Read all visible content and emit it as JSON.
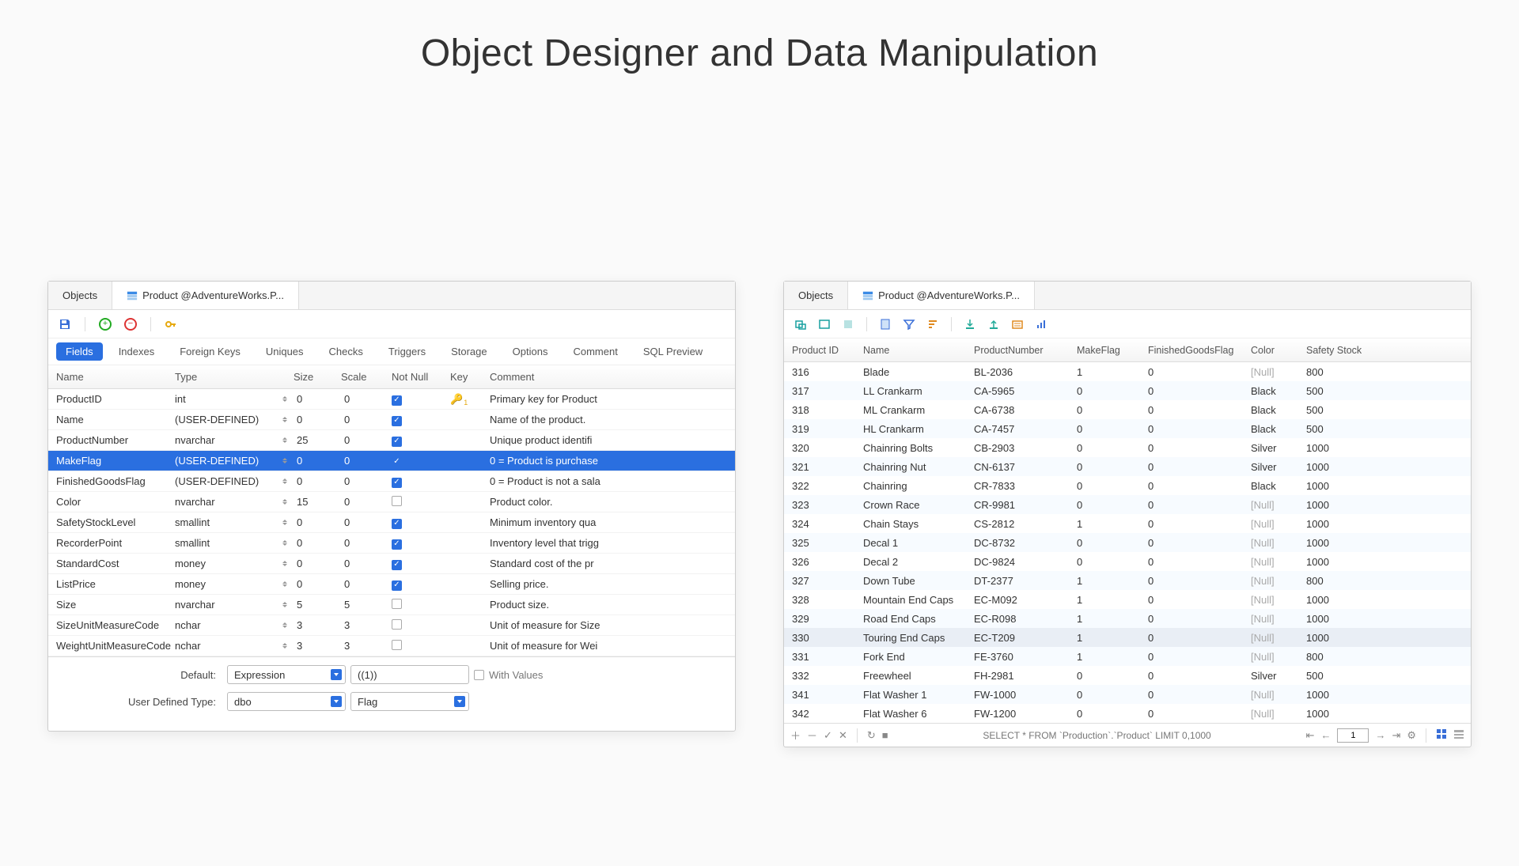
{
  "page": {
    "title": "Object Designer and Data Manipulation"
  },
  "designer": {
    "tabs": {
      "objects": "Objects",
      "product": "Product @AdventureWorks.P..."
    },
    "subtabs": [
      "Fields",
      "Indexes",
      "Foreign Keys",
      "Uniques",
      "Checks",
      "Triggers",
      "Storage",
      "Options",
      "Comment",
      "SQL Preview"
    ],
    "activeSubtab": 0,
    "columns": [
      "Name",
      "Type",
      "Size",
      "Scale",
      "Not Null",
      "Key",
      "Comment"
    ],
    "selectedRowIndex": 3,
    "rows": [
      {
        "name": "ProductID",
        "type": "int",
        "size": "0",
        "scale": "0",
        "notnull": true,
        "key": true,
        "comment": "Primary key for Product"
      },
      {
        "name": "Name",
        "type": "(USER-DEFINED)",
        "size": "0",
        "scale": "0",
        "notnull": true,
        "key": false,
        "comment": "Name of the product."
      },
      {
        "name": "ProductNumber",
        "type": "nvarchar",
        "size": "25",
        "scale": "0",
        "notnull": true,
        "key": false,
        "comment": "Unique product identifi"
      },
      {
        "name": "MakeFlag",
        "type": "(USER-DEFINED)",
        "size": "0",
        "scale": "0",
        "notnull": true,
        "key": false,
        "comment": "0 = Product is purchase"
      },
      {
        "name": "FinishedGoodsFlag",
        "type": "(USER-DEFINED)",
        "size": "0",
        "scale": "0",
        "notnull": true,
        "key": false,
        "comment": "0 = Product is not a sala"
      },
      {
        "name": "Color",
        "type": "nvarchar",
        "size": "15",
        "scale": "0",
        "notnull": false,
        "key": false,
        "comment": "Product color."
      },
      {
        "name": "SafetyStockLevel",
        "type": "smallint",
        "size": "0",
        "scale": "0",
        "notnull": true,
        "key": false,
        "comment": "Minimum inventory qua"
      },
      {
        "name": "RecorderPoint",
        "type": "smallint",
        "size": "0",
        "scale": "0",
        "notnull": true,
        "key": false,
        "comment": "Inventory level that trigg"
      },
      {
        "name": "StandardCost",
        "type": "money",
        "size": "0",
        "scale": "0",
        "notnull": true,
        "key": false,
        "comment": "Standard cost of the pr"
      },
      {
        "name": "ListPrice",
        "type": "money",
        "size": "0",
        "scale": "0",
        "notnull": true,
        "key": false,
        "comment": "Selling price."
      },
      {
        "name": "Size",
        "type": "nvarchar",
        "size": "5",
        "scale": "5",
        "notnull": false,
        "key": false,
        "comment": "Product size."
      },
      {
        "name": "SizeUnitMeasureCode",
        "type": "nchar",
        "size": "3",
        "scale": "3",
        "notnull": false,
        "key": false,
        "comment": "Unit of measure for Size"
      },
      {
        "name": "WeightUnitMeasureCode",
        "type": "nchar",
        "size": "3",
        "scale": "3",
        "notnull": false,
        "key": false,
        "comment": "Unit of measure for Wei"
      }
    ],
    "form": {
      "defaultLabel": "Default:",
      "defaultMode": "Expression",
      "defaultValue": "((1))",
      "withValues": "With Values",
      "udtLabel": "User Defined Type:",
      "udtSchema": "dbo",
      "udtName": "Flag"
    }
  },
  "dataview": {
    "tabs": {
      "objects": "Objects",
      "product": "Product @AdventureWorks.P..."
    },
    "columns": [
      "Product ID",
      "Name",
      "ProductNumber",
      "MakeFlag",
      "FinishedGoodsFlag",
      "Color",
      "Safety Stock"
    ],
    "rows": [
      {
        "pid": "316",
        "name": "Blade",
        "pn": "BL-2036",
        "mf": "1",
        "fg": "0",
        "color": "[Null]",
        "ss": "800"
      },
      {
        "pid": "317",
        "name": "LL Crankarm",
        "pn": "CA-5965",
        "mf": "0",
        "fg": "0",
        "color": "Black",
        "ss": "500"
      },
      {
        "pid": "318",
        "name": "ML Crankarm",
        "pn": "CA-6738",
        "mf": "0",
        "fg": "0",
        "color": "Black",
        "ss": "500"
      },
      {
        "pid": "319",
        "name": "HL Crankarm",
        "pn": "CA-7457",
        "mf": "0",
        "fg": "0",
        "color": "Black",
        "ss": "500"
      },
      {
        "pid": "320",
        "name": "Chainring Bolts",
        "pn": "CB-2903",
        "mf": "0",
        "fg": "0",
        "color": "Silver",
        "ss": "1000"
      },
      {
        "pid": "321",
        "name": "Chainring Nut",
        "pn": "CN-6137",
        "mf": "0",
        "fg": "0",
        "color": "Silver",
        "ss": "1000"
      },
      {
        "pid": "322",
        "name": "Chainring",
        "pn": "CR-7833",
        "mf": "0",
        "fg": "0",
        "color": "Black",
        "ss": "1000"
      },
      {
        "pid": "323",
        "name": "Crown Race",
        "pn": "CR-9981",
        "mf": "0",
        "fg": "0",
        "color": "[Null]",
        "ss": "1000"
      },
      {
        "pid": "324",
        "name": "Chain Stays",
        "pn": "CS-2812",
        "mf": "1",
        "fg": "0",
        "color": "[Null]",
        "ss": "1000"
      },
      {
        "pid": "325",
        "name": "Decal 1",
        "pn": "DC-8732",
        "mf": "0",
        "fg": "0",
        "color": "[Null]",
        "ss": "1000"
      },
      {
        "pid": "326",
        "name": "Decal 2",
        "pn": "DC-9824",
        "mf": "0",
        "fg": "0",
        "color": "[Null]",
        "ss": "1000"
      },
      {
        "pid": "327",
        "name": "Down Tube",
        "pn": "DT-2377",
        "mf": "1",
        "fg": "0",
        "color": "[Null]",
        "ss": "800"
      },
      {
        "pid": "328",
        "name": "Mountain End Caps",
        "pn": "EC-M092",
        "mf": "1",
        "fg": "0",
        "color": "[Null]",
        "ss": "1000"
      },
      {
        "pid": "329",
        "name": "Road End Caps",
        "pn": "EC-R098",
        "mf": "1",
        "fg": "0",
        "color": "[Null]",
        "ss": "1000"
      },
      {
        "pid": "330",
        "name": "Touring End Caps",
        "pn": "EC-T209",
        "mf": "1",
        "fg": "0",
        "color": "[Null]",
        "ss": "1000",
        "hl": true
      },
      {
        "pid": "331",
        "name": "Fork End",
        "pn": "FE-3760",
        "mf": "1",
        "fg": "0",
        "color": "[Null]",
        "ss": "800"
      },
      {
        "pid": "332",
        "name": "Freewheel",
        "pn": "FH-2981",
        "mf": "0",
        "fg": "0",
        "color": "Silver",
        "ss": "500"
      },
      {
        "pid": "341",
        "name": "Flat Washer 1",
        "pn": "FW-1000",
        "mf": "0",
        "fg": "0",
        "color": "[Null]",
        "ss": "1000"
      },
      {
        "pid": "342",
        "name": "Flat Washer 6",
        "pn": "FW-1200",
        "mf": "0",
        "fg": "0",
        "color": "[Null]",
        "ss": "1000"
      }
    ],
    "statusbar": {
      "sql": "SELECT * FROM `Production`.`Product` LIMIT 0,1000",
      "page": "1"
    }
  }
}
